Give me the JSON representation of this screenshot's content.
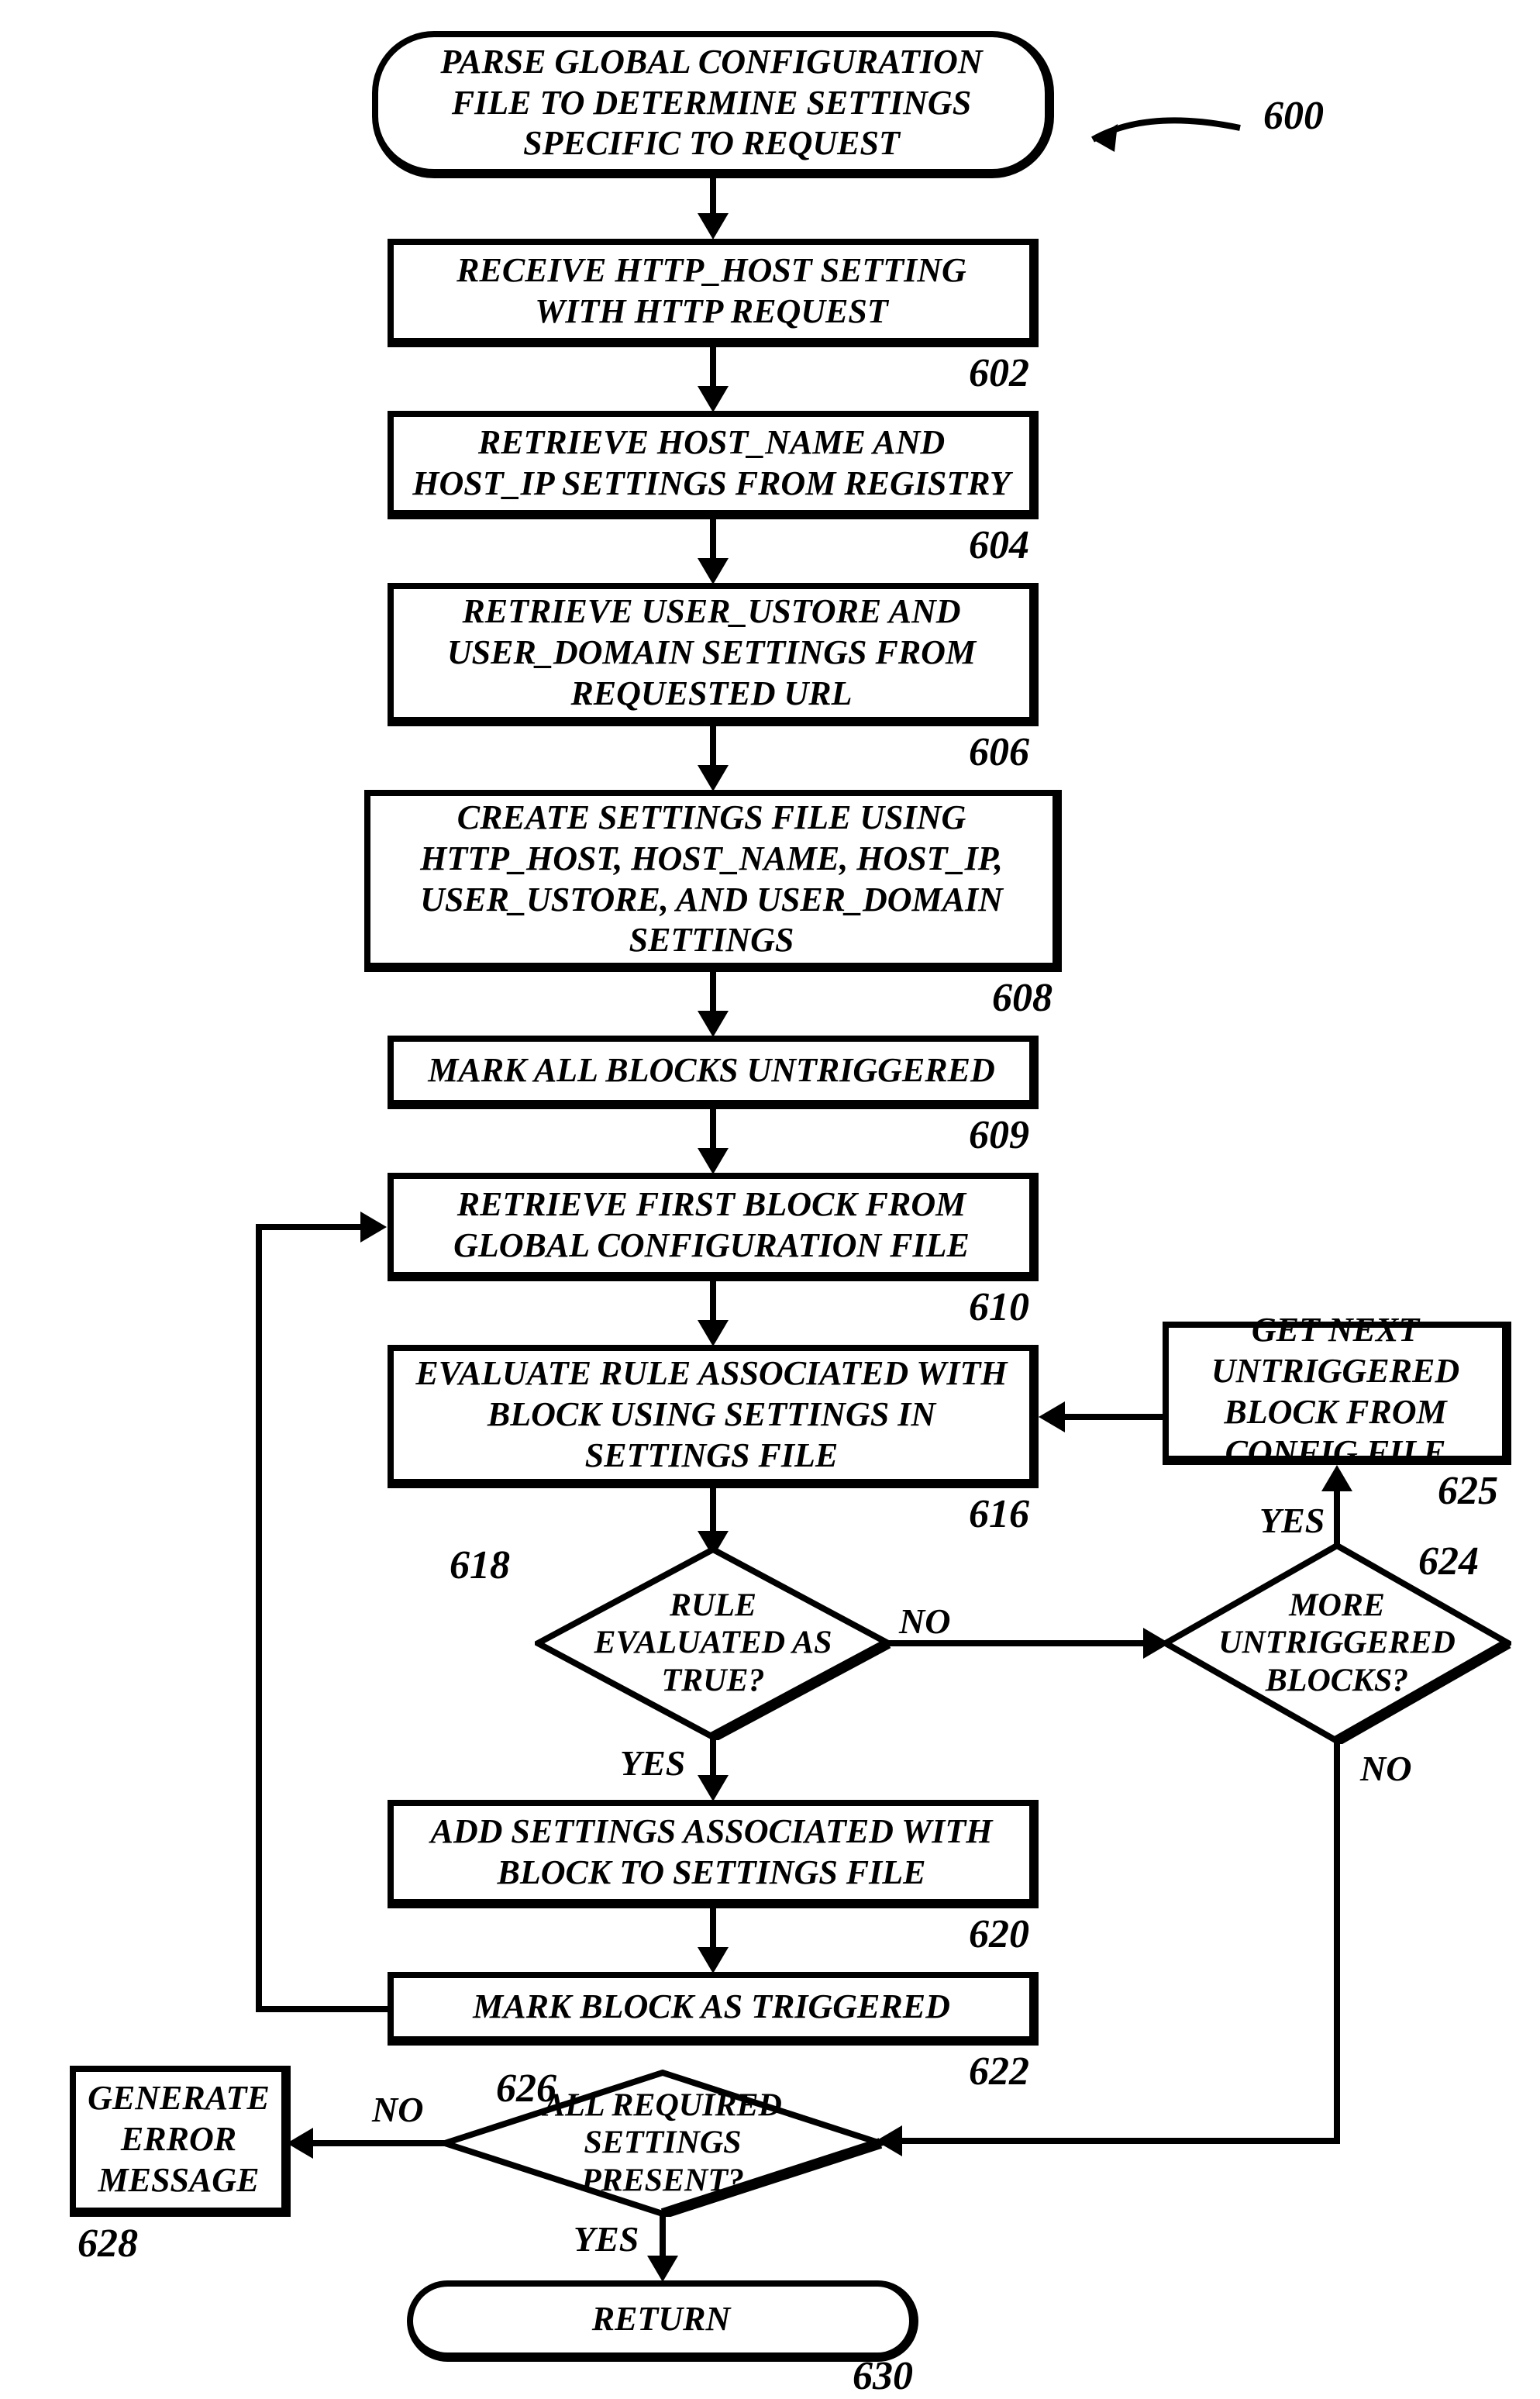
{
  "chart_data": {
    "type": "flowchart",
    "nodes": [
      {
        "id": "600",
        "kind": "terminator",
        "text": "PARSE GLOBAL CONFIGURATION FILE TO DETERMINE SETTINGS SPECIFIC TO REQUEST"
      },
      {
        "id": "602",
        "kind": "process",
        "text": "RECEIVE HTTP_HOST SETTING WITH HTTP REQUEST"
      },
      {
        "id": "604",
        "kind": "process",
        "text": "RETRIEVE HOST_NAME AND HOST_IP SETTINGS FROM REGISTRY"
      },
      {
        "id": "606",
        "kind": "process",
        "text": "RETRIEVE USER_USTORE AND USER_DOMAIN SETTINGS FROM REQUESTED URL"
      },
      {
        "id": "608",
        "kind": "process",
        "text": "CREATE SETTINGS FILE USING HTTP_HOST, HOST_NAME, HOST_IP, USER_USTORE, AND USER_DOMAIN SETTINGS"
      },
      {
        "id": "609",
        "kind": "process",
        "text": "MARK ALL BLOCKS UNTRIGGERED"
      },
      {
        "id": "610",
        "kind": "process",
        "text": "RETRIEVE FIRST BLOCK FROM GLOBAL CONFIGURATION FILE"
      },
      {
        "id": "616",
        "kind": "process",
        "text": "EVALUATE RULE ASSOCIATED WITH BLOCK USING SETTINGS IN SETTINGS FILE"
      },
      {
        "id": "618",
        "kind": "decision",
        "text": "RULE EVALUATED AS TRUE?"
      },
      {
        "id": "620",
        "kind": "process",
        "text": "ADD SETTINGS ASSOCIATED WITH BLOCK TO SETTINGS FILE"
      },
      {
        "id": "622",
        "kind": "process",
        "text": "MARK BLOCK AS TRIGGERED"
      },
      {
        "id": "624",
        "kind": "decision",
        "text": "MORE UNTRIGGERED BLOCKS?"
      },
      {
        "id": "625",
        "kind": "process",
        "text": "GET NEXT UNTRIGGERED BLOCK FROM CONFIG FILE"
      },
      {
        "id": "626",
        "kind": "decision",
        "text": "ALL REQUIRED SETTINGS PRESENT?"
      },
      {
        "id": "628",
        "kind": "process",
        "text": "GENERATE ERROR MESSAGE"
      },
      {
        "id": "630",
        "kind": "terminator",
        "text": "RETURN"
      }
    ],
    "edges": [
      {
        "from": "600",
        "to": "602"
      },
      {
        "from": "602",
        "to": "604"
      },
      {
        "from": "604",
        "to": "606"
      },
      {
        "from": "606",
        "to": "608"
      },
      {
        "from": "608",
        "to": "609"
      },
      {
        "from": "609",
        "to": "610"
      },
      {
        "from": "610",
        "to": "616"
      },
      {
        "from": "616",
        "to": "618"
      },
      {
        "from": "618",
        "to": "620",
        "label": "YES"
      },
      {
        "from": "618",
        "to": "624",
        "label": "NO"
      },
      {
        "from": "620",
        "to": "622"
      },
      {
        "from": "622",
        "to": "610"
      },
      {
        "from": "624",
        "to": "625",
        "label": "YES"
      },
      {
        "from": "625",
        "to": "616"
      },
      {
        "from": "624",
        "to": "626",
        "label": "NO"
      },
      {
        "from": "626",
        "to": "628",
        "label": "NO"
      },
      {
        "from": "626",
        "to": "630",
        "label": "YES"
      }
    ]
  },
  "labels": {
    "n600": "600",
    "n602": "602",
    "n604": "604",
    "n606": "606",
    "n608": "608",
    "n609": "609",
    "n610": "610",
    "n616": "616",
    "n618": "618",
    "n620": "620",
    "n622": "622",
    "n624": "624",
    "n625": "625",
    "n626": "626",
    "n628": "628",
    "n630": "630",
    "yes": "YES",
    "no": "NO"
  }
}
